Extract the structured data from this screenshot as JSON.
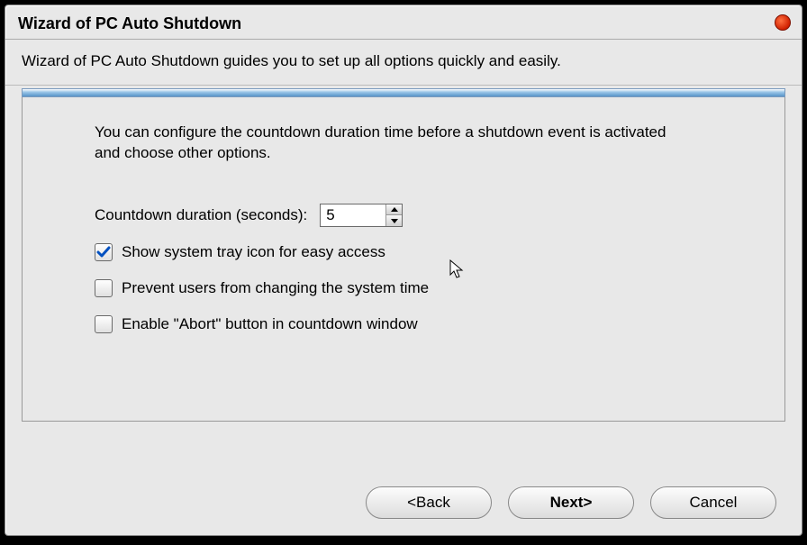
{
  "title": "Wizard of PC Auto Shutdown",
  "subtitle": "Wizard of PC Auto Shutdown guides you to set up all options quickly and easily.",
  "panel": {
    "description": "You can configure the countdown duration time before a shutdown event is activated and choose other options.",
    "countdown_label": "Countdown duration (seconds):",
    "countdown_value": "5",
    "options": [
      {
        "label": "Show system tray icon for easy access",
        "checked": true
      },
      {
        "label": "Prevent users from changing the system time",
        "checked": false
      },
      {
        "label": "Enable \"Abort\" button in countdown window",
        "checked": false
      }
    ]
  },
  "buttons": {
    "back": "<Back",
    "next": "Next>",
    "cancel": "Cancel"
  }
}
